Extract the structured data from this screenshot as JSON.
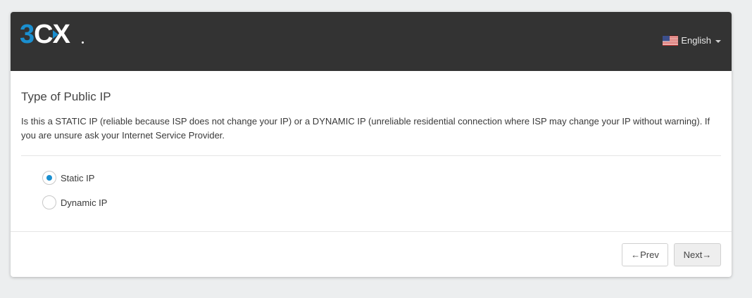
{
  "header": {
    "logo": "3CX",
    "language": {
      "label": "English",
      "icon": "us-flag-icon"
    }
  },
  "content": {
    "title": "Type of Public IP",
    "description": "Is this a STATIC IP (reliable because ISP does not change your IP) or a DYNAMIC IP (unreliable residential connection where ISP may change your IP without warning). If you are unsure ask your Internet Service Provider.",
    "options": [
      {
        "label": "Static IP",
        "selected": true
      },
      {
        "label": "Dynamic IP",
        "selected": false
      }
    ]
  },
  "footer": {
    "prev_label": "←Prev",
    "next_label": "Next→"
  },
  "colors": {
    "header_bg": "#333333",
    "accent": "#1a8fd0"
  }
}
